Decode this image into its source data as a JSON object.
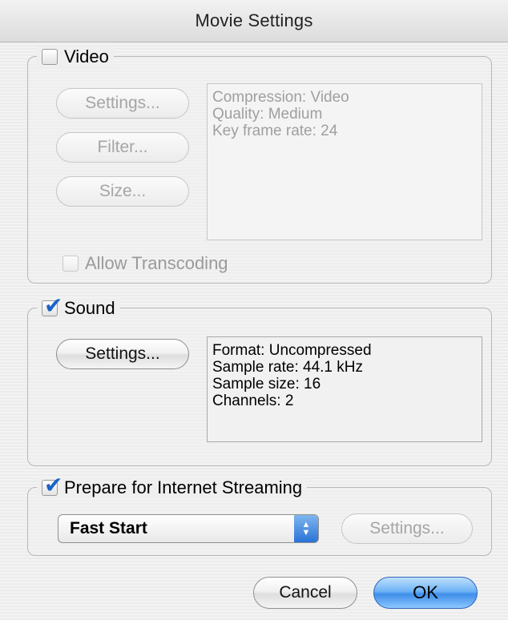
{
  "window": {
    "title": "Movie Settings"
  },
  "video": {
    "label": "Video",
    "checked": false,
    "buttons": {
      "settings": "Settings...",
      "filter": "Filter...",
      "size": "Size..."
    },
    "info": [
      "Compression: Video",
      "Quality: Medium",
      "Key frame rate: 24"
    ],
    "allow_transcoding": {
      "label": "Allow Transcoding",
      "checked": false
    }
  },
  "sound": {
    "label": "Sound",
    "checked": true,
    "buttons": {
      "settings": "Settings..."
    },
    "info": [
      "Format: Uncompressed",
      "Sample rate: 44.1 kHz",
      "Sample size: 16",
      "Channels: 2"
    ]
  },
  "streaming": {
    "label": "Prepare for Internet Streaming",
    "checked": true,
    "select_value": "Fast Start",
    "settings_label": "Settings..."
  },
  "footer": {
    "cancel": "Cancel",
    "ok": "OK"
  },
  "colors": {
    "accent": "#3f8ee9",
    "checkmark": "#1a63c8"
  },
  "icons": {
    "check": "checkmark-icon",
    "popup": "popup-arrows-icon"
  }
}
